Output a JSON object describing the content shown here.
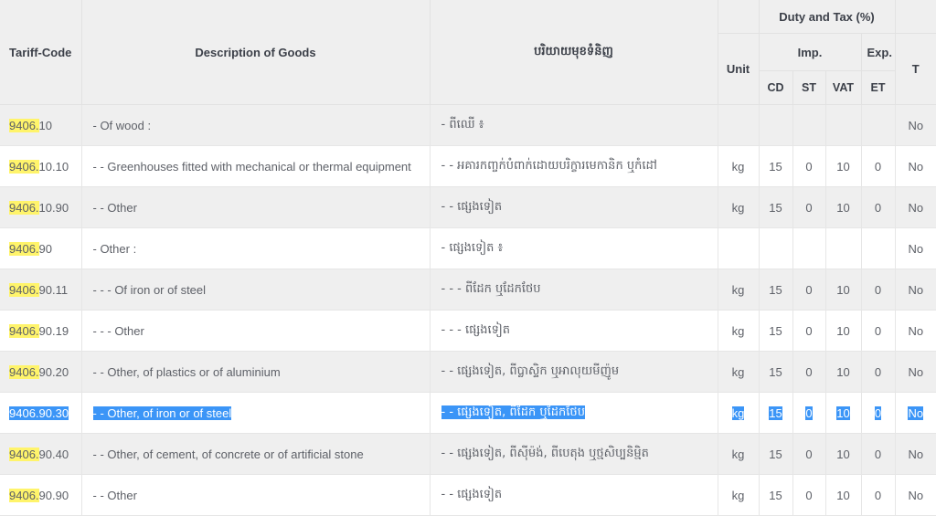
{
  "table": {
    "header": {
      "duty_and_tax": "Duty and Tax (%)",
      "tariff_code": "Tariff-Code",
      "description_of_goods": "Description of Goods",
      "description_khmer": "បរិយាយមុខទំនិញ",
      "unit": "Unit",
      "imp": "Imp.",
      "exp": "Exp.",
      "t": "T",
      "cd": "CD",
      "st": "ST",
      "vat": "VAT",
      "et": "ET"
    },
    "highlight_prefix": "9406.",
    "colors": {
      "search_highlight": "#fff46b",
      "selection": "#3b95f7",
      "row_stripe": "#efefef",
      "header_bg": "#efefef",
      "border": "#e6e6e6",
      "text": "#5e6168"
    },
    "rows": [
      {
        "code_prefix": "9406.",
        "code_rest": "10",
        "description": "- Of wood :",
        "description_khmer": "- ពីឈើ ៖",
        "unit": "",
        "cd": "",
        "st": "",
        "vat": "",
        "et": "",
        "t": "No",
        "stripe": "odd",
        "selected": false
      },
      {
        "code_prefix": "9406.",
        "code_rest": "10.10",
        "description": "- - Greenhouses fitted with mechanical or thermal equipment",
        "description_khmer": "- - អគារកញ្ចក់បំពាក់ដោយបរិក្ខារមេកានិក ឬកំដៅ",
        "unit": "kg",
        "cd": "15",
        "st": "0",
        "vat": "10",
        "et": "0",
        "t": "No",
        "stripe": "even",
        "selected": false
      },
      {
        "code_prefix": "9406.",
        "code_rest": "10.90",
        "description": "- - Other",
        "description_khmer": "- - ផ្សេងទៀត",
        "unit": "kg",
        "cd": "15",
        "st": "0",
        "vat": "10",
        "et": "0",
        "t": "No",
        "stripe": "odd",
        "selected": false
      },
      {
        "code_prefix": "9406.",
        "code_rest": "90",
        "description": "- Other :",
        "description_khmer": "- ផ្សេងទៀត ៖",
        "unit": "",
        "cd": "",
        "st": "",
        "vat": "",
        "et": "",
        "t": "No",
        "stripe": "even",
        "selected": false
      },
      {
        "code_prefix": "9406.",
        "code_rest": "90.11",
        "description": "- - - Of iron or of steel",
        "description_khmer": "- - - ពីដែក ឬដែកថែប",
        "unit": "kg",
        "cd": "15",
        "st": "0",
        "vat": "10",
        "et": "0",
        "t": "No",
        "stripe": "odd",
        "selected": false
      },
      {
        "code_prefix": "9406.",
        "code_rest": "90.19",
        "description": "- - - Other",
        "description_khmer": "- - - ផ្សេងទៀត",
        "unit": "kg",
        "cd": "15",
        "st": "0",
        "vat": "10",
        "et": "0",
        "t": "No",
        "stripe": "even",
        "selected": false
      },
      {
        "code_prefix": "9406.",
        "code_rest": "90.20",
        "description": "- - Other, of plastics or of aluminium",
        "description_khmer": "- - ផ្សេងទៀត, ពីប្លាស្ទិក ឬអាលុយមីញ៉ូម",
        "unit": "kg",
        "cd": "15",
        "st": "0",
        "vat": "10",
        "et": "0",
        "t": "No",
        "stripe": "odd",
        "selected": false
      },
      {
        "code_prefix": "9406.",
        "code_rest": "90.30",
        "description": "- - Other, of iron or of steel",
        "description_khmer": "- - ផ្សេងទៀត, ពីដែក ឬដែកថែប",
        "unit": "kg",
        "cd": "15",
        "st": "0",
        "vat": "10",
        "et": "0",
        "t": "No",
        "stripe": "even",
        "selected": true
      },
      {
        "code_prefix": "9406.",
        "code_rest": "90.40",
        "description": "- - Other, of cement, of concrete or of artificial stone",
        "description_khmer": "- - ផ្សេងទៀត, ពីស៊ីម៉ង់, ពីបេតុង ឬថ្មសិប្បនិម្មិត",
        "unit": "kg",
        "cd": "15",
        "st": "0",
        "vat": "10",
        "et": "0",
        "t": "No",
        "stripe": "odd",
        "selected": false
      },
      {
        "code_prefix": "9406.",
        "code_rest": "90.90",
        "description": "- - Other",
        "description_khmer": "- - ផ្សេងទៀត",
        "unit": "kg",
        "cd": "15",
        "st": "0",
        "vat": "10",
        "et": "0",
        "t": "No",
        "stripe": "even",
        "selected": false
      }
    ]
  }
}
